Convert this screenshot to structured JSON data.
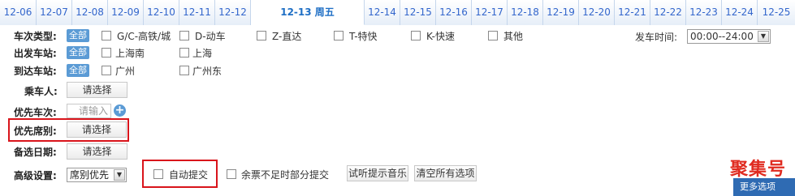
{
  "date_tabs": [
    {
      "label": "12-06"
    },
    {
      "label": "12-07"
    },
    {
      "label": "12-08"
    },
    {
      "label": "12-09"
    },
    {
      "label": "12-10"
    },
    {
      "label": "12-11"
    },
    {
      "label": "12-12"
    },
    {
      "label": "12-13 周五"
    },
    {
      "label": "12-14"
    },
    {
      "label": "12-15"
    },
    {
      "label": "12-16"
    },
    {
      "label": "12-17"
    },
    {
      "label": "12-18"
    },
    {
      "label": "12-19"
    },
    {
      "label": "12-20"
    },
    {
      "label": "12-21"
    },
    {
      "label": "12-22"
    },
    {
      "label": "12-23"
    },
    {
      "label": "12-24"
    },
    {
      "label": "12-25"
    }
  ],
  "active_tab": "12-13 周五",
  "train_type": {
    "label": "车次类型:",
    "all": "全部",
    "options": [
      "G/C-高铁/城",
      "D-动车",
      "Z-直达",
      "T-特快",
      "K-快速",
      "其他"
    ]
  },
  "depart_time": {
    "label": "发车时间:",
    "value": "00:00--24:00"
  },
  "from_station": {
    "label": "出发车站:",
    "all": "全部",
    "options": [
      "上海南",
      "上海"
    ]
  },
  "to_station": {
    "label": "到达车站:",
    "all": "全部",
    "options": [
      "广州",
      "广州东"
    ]
  },
  "passenger": {
    "label": "乘车人:",
    "button": "请选择"
  },
  "priority_train": {
    "label": "优先车次:",
    "placeholder": "请输入",
    "add": "+"
  },
  "priority_seat": {
    "label": "优先席别:",
    "button": "请选择"
  },
  "alt_date": {
    "label": "备选日期:",
    "button": "请选择"
  },
  "advanced": {
    "label": "高级设置:",
    "select_value": "席别优先",
    "auto_submit": "自动提交",
    "partial_submit": "余票不足时部分提交",
    "test_music": "试听提示音乐",
    "clear_all": "清空所有选项"
  },
  "watermark": "聚集号",
  "more_options": "更多选项"
}
